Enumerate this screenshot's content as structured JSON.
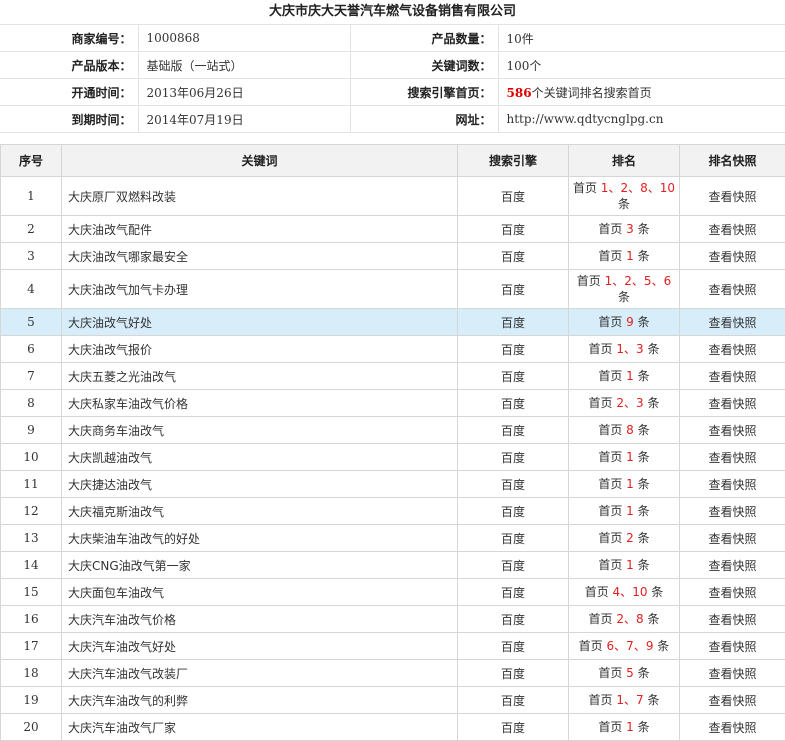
{
  "company": "大庆市庆大天誉汽车燃气设备销售有限公司",
  "info": [
    {
      "l1": "商家编号：",
      "v1": "1000868",
      "l2": "产品数量：",
      "v2": "10件"
    },
    {
      "l1": "产品版本：",
      "v1": "基础版（一站式）",
      "l2": "关键词数：",
      "v2": "100个"
    },
    {
      "l1": "开通时间：",
      "v1": "2013年06月26日",
      "l2": "搜索引擎首页：",
      "v2_num": "586",
      "v2": "个关键词排名搜索首页"
    },
    {
      "l1": "到期时间：",
      "v1": "2014年07月19日",
      "l2": "网址：",
      "v2": "http://www.qdtycnglpg.cn"
    }
  ],
  "table": {
    "headers": [
      "序号",
      "关键词",
      "搜索引擎",
      "排名",
      "排名快照"
    ],
    "rank_prefix": "首页",
    "rank_suffix": "条",
    "rows": [
      {
        "no": "1",
        "kw": "大庆原厂双燃料改装",
        "engine": "百度",
        "ranks": [
          "1",
          "2",
          "8",
          "10"
        ],
        "snap": "查看快照",
        "tall": true
      },
      {
        "no": "2",
        "kw": "大庆油改气配件",
        "engine": "百度",
        "ranks": [
          "3"
        ],
        "snap": "查看快照"
      },
      {
        "no": "3",
        "kw": "大庆油改气哪家最安全",
        "engine": "百度",
        "ranks": [
          "1"
        ],
        "snap": "查看快照"
      },
      {
        "no": "4",
        "kw": "大庆油改气加气卡办理",
        "engine": "百度",
        "ranks": [
          "1",
          "2",
          "5",
          "6"
        ],
        "snap": "查看快照",
        "tall": true
      },
      {
        "no": "5",
        "kw": "大庆油改气好处",
        "engine": "百度",
        "ranks": [
          "9"
        ],
        "snap": "查看快照",
        "highlight": true
      },
      {
        "no": "6",
        "kw": "大庆油改气报价",
        "engine": "百度",
        "ranks": [
          "1",
          "3"
        ],
        "snap": "查看快照"
      },
      {
        "no": "7",
        "kw": "大庆五菱之光油改气",
        "engine": "百度",
        "ranks": [
          "1"
        ],
        "snap": "查看快照"
      },
      {
        "no": "8",
        "kw": "大庆私家车油改气价格",
        "engine": "百度",
        "ranks": [
          "2",
          "3"
        ],
        "snap": "查看快照"
      },
      {
        "no": "9",
        "kw": "大庆商务车油改气",
        "engine": "百度",
        "ranks": [
          "8"
        ],
        "snap": "查看快照"
      },
      {
        "no": "10",
        "kw": "大庆凯越油改气",
        "engine": "百度",
        "ranks": [
          "1"
        ],
        "snap": "查看快照"
      },
      {
        "no": "11",
        "kw": "大庆捷达油改气",
        "engine": "百度",
        "ranks": [
          "1"
        ],
        "snap": "查看快照"
      },
      {
        "no": "12",
        "kw": "大庆福克斯油改气",
        "engine": "百度",
        "ranks": [
          "1"
        ],
        "snap": "查看快照"
      },
      {
        "no": "13",
        "kw": "大庆柴油车油改气的好处",
        "engine": "百度",
        "ranks": [
          "2"
        ],
        "snap": "查看快照"
      },
      {
        "no": "14",
        "kw": "大庆CNG油改气第一家",
        "engine": "百度",
        "ranks": [
          "1"
        ],
        "snap": "查看快照"
      },
      {
        "no": "15",
        "kw": "大庆面包车油改气",
        "engine": "百度",
        "ranks": [
          "4",
          "10"
        ],
        "snap": "查看快照"
      },
      {
        "no": "16",
        "kw": "大庆汽车油改气价格",
        "engine": "百度",
        "ranks": [
          "2",
          "8"
        ],
        "snap": "查看快照"
      },
      {
        "no": "17",
        "kw": "大庆汽车油改气好处",
        "engine": "百度",
        "ranks": [
          "6",
          "7",
          "9"
        ],
        "snap": "查看快照"
      },
      {
        "no": "18",
        "kw": "大庆汽车油改气改装厂",
        "engine": "百度",
        "ranks": [
          "5"
        ],
        "snap": "查看快照"
      },
      {
        "no": "19",
        "kw": "大庆汽车油改气的利弊",
        "engine": "百度",
        "ranks": [
          "1",
          "7"
        ],
        "snap": "查看快照"
      },
      {
        "no": "20",
        "kw": "大庆汽车油改气厂家",
        "engine": "百度",
        "ranks": [
          "1"
        ],
        "snap": "查看快照"
      }
    ]
  }
}
